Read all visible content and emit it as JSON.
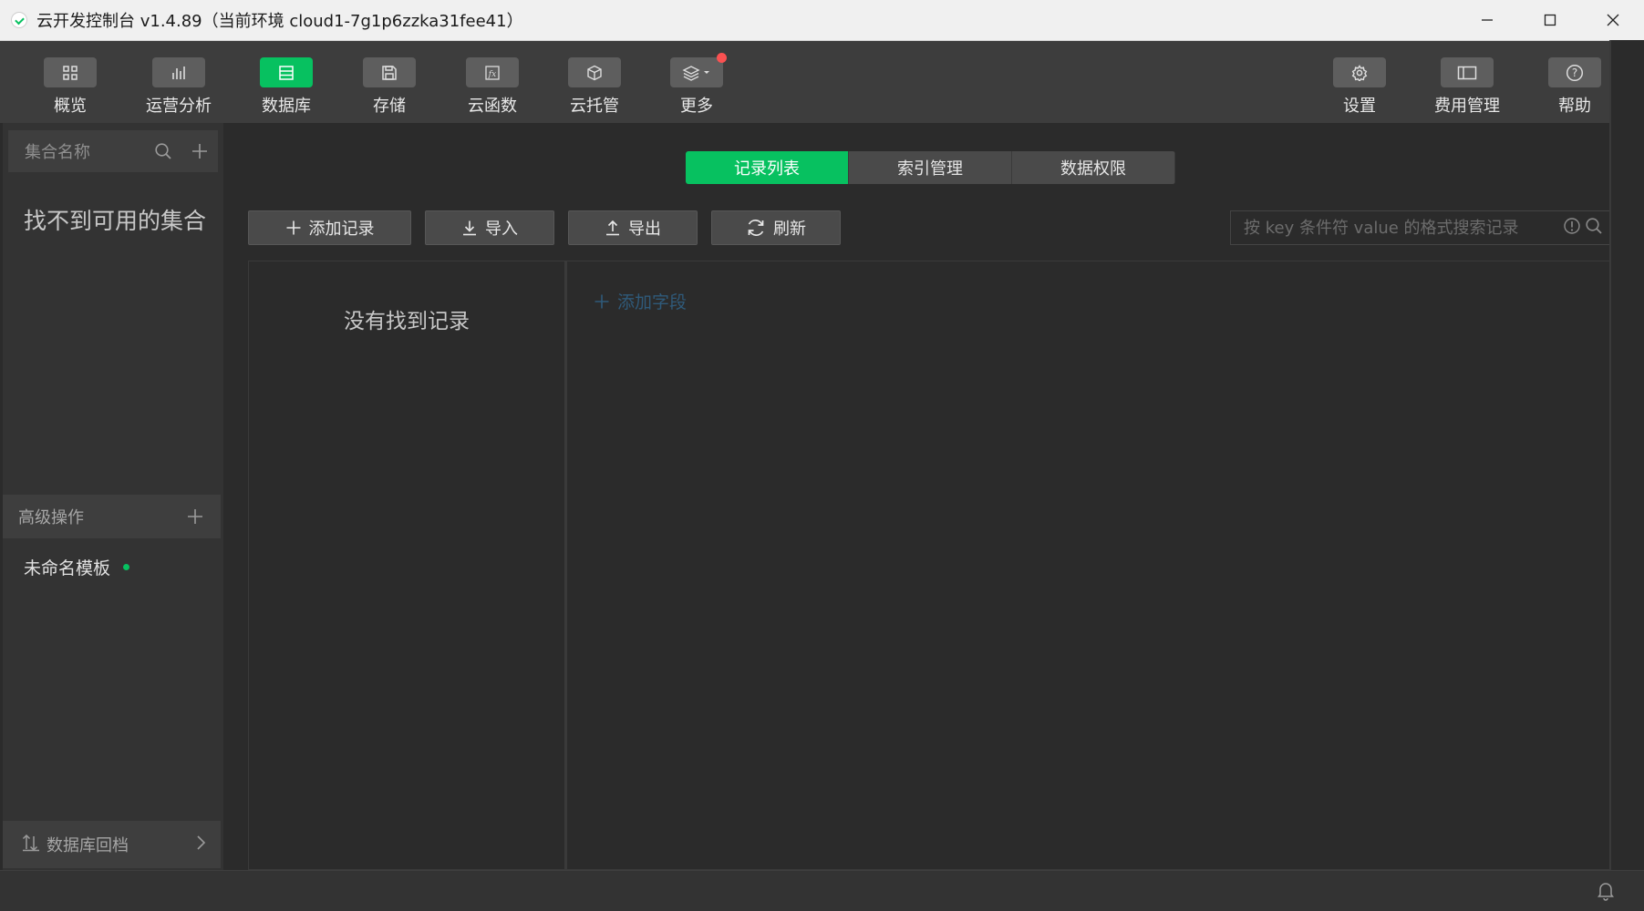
{
  "window": {
    "title": "云开发控制台 v1.4.89（当前环境 cloud1-7g1p6zzka31fee41）"
  },
  "toolbar": {
    "items": [
      {
        "label": "概览",
        "icon": "grid-icon"
      },
      {
        "label": "运营分析",
        "icon": "bar-chart-icon"
      },
      {
        "label": "数据库",
        "icon": "database-icon",
        "active": true
      },
      {
        "label": "存储",
        "icon": "save-icon"
      },
      {
        "label": "云函数",
        "icon": "function-icon"
      },
      {
        "label": "云托管",
        "icon": "cube-icon"
      },
      {
        "label": "更多",
        "icon": "layers-icon"
      }
    ],
    "right_items": [
      {
        "label": "设置",
        "icon": "gear-icon"
      },
      {
        "label": "费用管理",
        "icon": "billing-icon"
      },
      {
        "label": "帮助",
        "icon": "help-icon"
      }
    ]
  },
  "sidebar": {
    "collection_header": "集合名称",
    "empty_text": "找不到可用的集合",
    "advanced_header": "高级操作",
    "template_item": "未命名模板",
    "rollback": "数据库回档"
  },
  "main": {
    "tabs": [
      {
        "label": "记录列表",
        "active": true
      },
      {
        "label": "索引管理"
      },
      {
        "label": "数据权限"
      }
    ],
    "actions": {
      "add": "添加记录",
      "import": "导入",
      "export": "导出",
      "refresh": "刷新"
    },
    "search": {
      "placeholder": "按 key 条件符 value 的格式搜索记录"
    },
    "no_records": "没有找到记录",
    "add_field": "添加字段"
  },
  "colors": {
    "accent": "#07c160",
    "badge": "#fa5151",
    "background": "#2b2b2b"
  }
}
